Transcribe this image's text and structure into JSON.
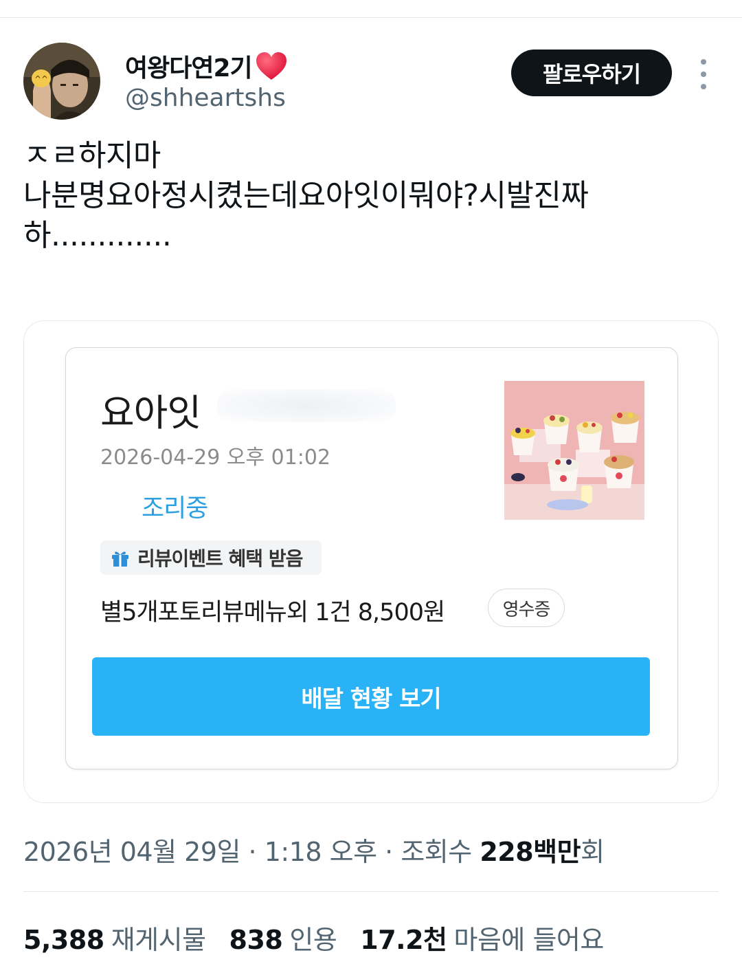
{
  "profile": {
    "display_name": "여왕다연2기",
    "name_emoji": "heart-emoji-icon",
    "handle": "@shheartshs",
    "follow_label": "팔로우하기",
    "more_icon": "more-vertical-icon"
  },
  "tweet": {
    "lines": [
      "ㅈㄹ하지마",
      "나분명요아정시켰는데요아잇이뭐야?시발진짜",
      "하............."
    ]
  },
  "order_card": {
    "shop_name": "요아잇",
    "date": "2026-04-29 오후 01:02",
    "status": "조리중",
    "review_badge": "리뷰이벤트 혜택 받음",
    "summary": "별5개포토리뷰메뉴외 1건 8,500원",
    "receipt_label": "영수증",
    "delivery_button": "배달 현황 보기",
    "accent_color": "#29b2f6"
  },
  "meta": {
    "date": "2026년 04월 29일",
    "time": "1:18 오후",
    "views_label": "조회수",
    "views_count": "228백만",
    "views_suffix": "회"
  },
  "stats": {
    "retweets_count": "5,388",
    "retweets_label": "재게시물",
    "quotes_count": "838",
    "quotes_label": "인용",
    "likes_count": "17.2천",
    "likes_label": "마음에 들어요"
  }
}
